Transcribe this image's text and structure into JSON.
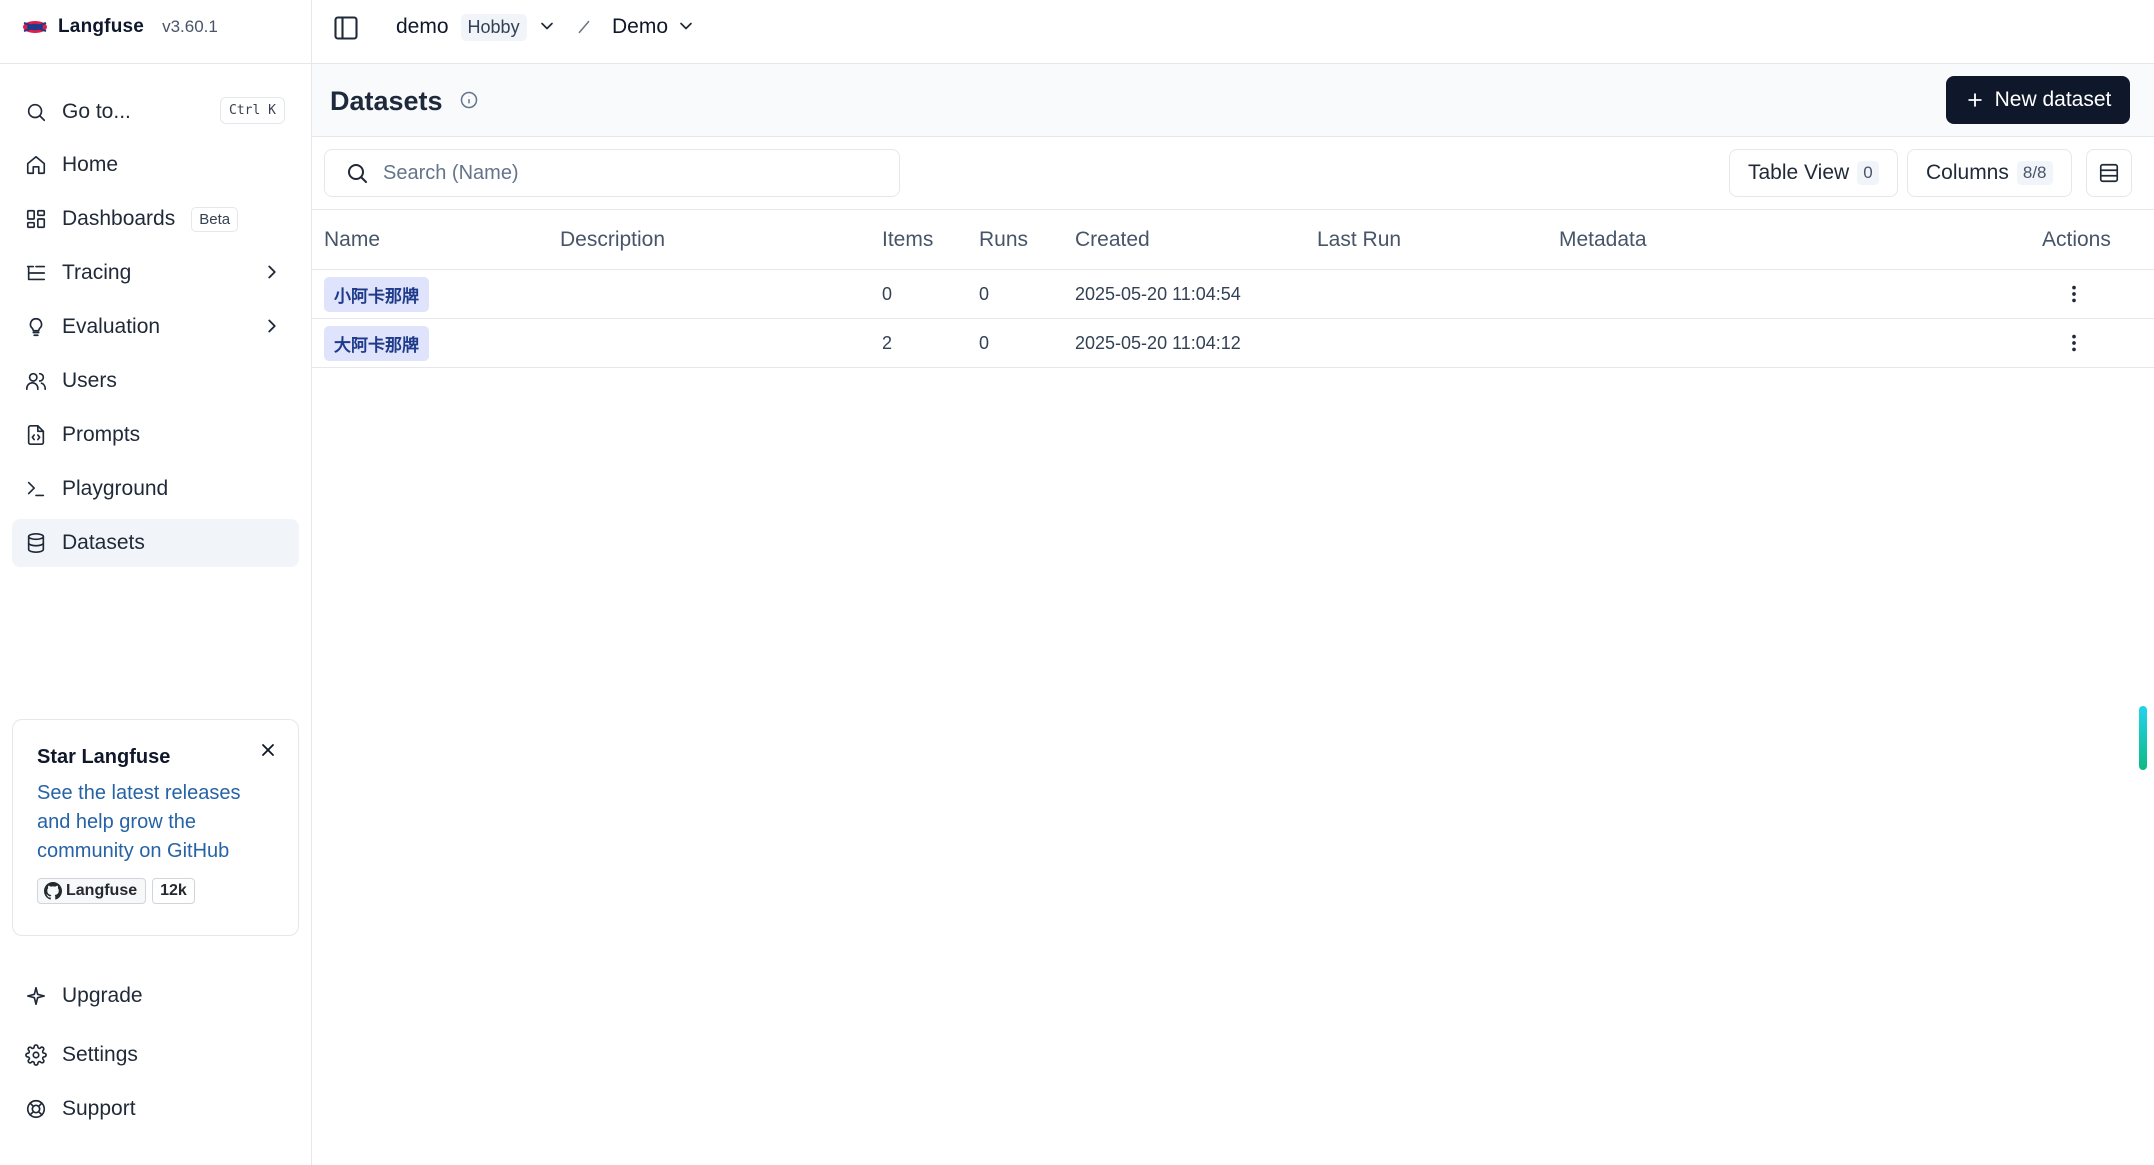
{
  "brand": {
    "name": "Langfuse",
    "version": "v3.60.1"
  },
  "sidebar": {
    "goto": {
      "label": "Go to...",
      "shortcut": "Ctrl K"
    },
    "items": [
      {
        "label": "Home",
        "icon": "home-icon"
      },
      {
        "label": "Dashboards",
        "icon": "dashboard-icon",
        "badge": "Beta"
      },
      {
        "label": "Tracing",
        "icon": "tracing-icon"
      },
      {
        "label": "Evaluation",
        "icon": "lightbulb-icon"
      },
      {
        "label": "Users",
        "icon": "users-icon"
      },
      {
        "label": "Prompts",
        "icon": "file-code-icon"
      },
      {
        "label": "Playground",
        "icon": "terminal-icon"
      },
      {
        "label": "Datasets",
        "icon": "database-icon",
        "active": true
      }
    ],
    "bottom_items": [
      {
        "label": "Upgrade",
        "icon": "sparkle-icon"
      },
      {
        "label": "Settings",
        "icon": "gear-icon"
      },
      {
        "label": "Support",
        "icon": "lifebuoy-icon"
      }
    ],
    "star_card": {
      "title": "Star Langfuse",
      "text": "See the latest releases and help grow the community on GitHub",
      "github_label": "Langfuse",
      "github_count": "12k"
    }
  },
  "topbar": {
    "org": "demo",
    "plan": "Hobby",
    "project": "Demo"
  },
  "page": {
    "title": "Datasets",
    "new_button": "New dataset",
    "search_placeholder": "Search (Name)",
    "table_view": {
      "label": "Table View",
      "count": "0"
    },
    "columns": {
      "label": "Columns",
      "count": "8/8"
    }
  },
  "table": {
    "headers": {
      "name": "Name",
      "description": "Description",
      "items": "Items",
      "runs": "Runs",
      "created": "Created",
      "last_run": "Last Run",
      "metadata": "Metadata",
      "actions": "Actions"
    },
    "rows": [
      {
        "name": "小阿卡那牌",
        "description": "",
        "items": "0",
        "runs": "0",
        "created": "2025-05-20 11:04:54",
        "last_run": "",
        "metadata": ""
      },
      {
        "name": "大阿卡那牌",
        "description": "",
        "items": "2",
        "runs": "0",
        "created": "2025-05-20 11:04:12",
        "last_run": "",
        "metadata": ""
      }
    ]
  }
}
